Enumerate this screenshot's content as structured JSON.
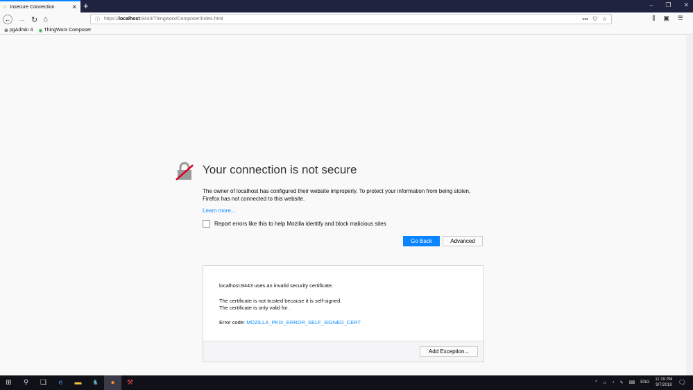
{
  "browser": {
    "tab_title": "Insecure Connection",
    "url_prefix": "https://",
    "url_host": "localhost",
    "url_rest": ":8443/Thingworx/Composer/index.html",
    "bookmarks": [
      {
        "label": "pgAdmin 4"
      },
      {
        "label": "ThingWorx Composer"
      }
    ]
  },
  "page": {
    "title": "Your connection is not secure",
    "description": "The owner of localhost has configured their website improperly. To protect your information from being stolen, Firefox has not connected to this website.",
    "learn_more": "Learn more...",
    "report_label": "Report errors like this to help Mozilla identify and block malicious sites",
    "go_back": "Go Back",
    "advanced": "Advanced",
    "details": {
      "line1": "localhost:8443 uses an invalid security certificate.",
      "line2": "The certificate is not trusted because it is self-signed.",
      "line3": "The certificate is only valid for .",
      "error_prefix": "Error code: ",
      "error_code": "MOZILLA_PKIX_ERROR_SELF_SIGNED_CERT",
      "add_exception": "Add Exception..."
    }
  },
  "taskbar": {
    "lang": "ENG",
    "time": "11:19 PM",
    "date": "9/7/2018"
  }
}
